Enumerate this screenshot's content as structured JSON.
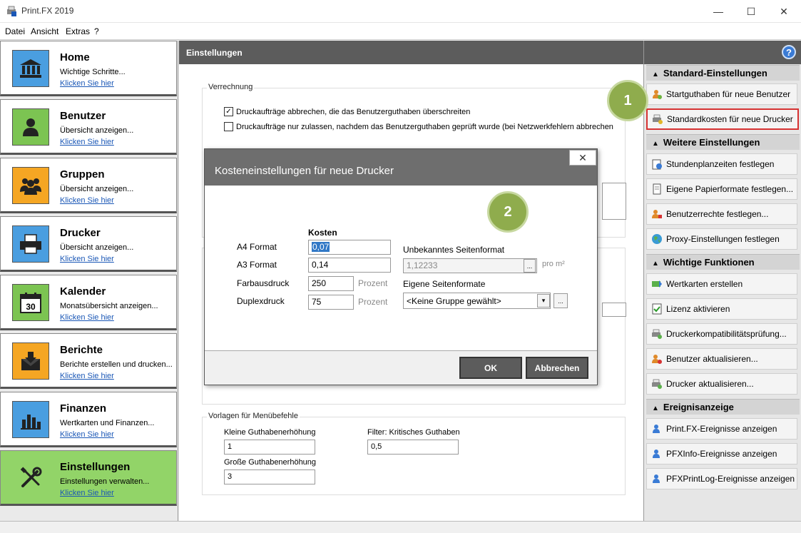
{
  "window": {
    "title": "Print.FX 2019"
  },
  "menu": [
    "Datei",
    "Ansicht",
    "Extras",
    "?"
  ],
  "nav": [
    {
      "title": "Home",
      "subtitle": "Wichtige Schritte...",
      "link": "Klicken Sie hier",
      "icon": "home-icon",
      "color": "#4a9ee0"
    },
    {
      "title": "Benutzer",
      "subtitle": "Übersicht anzeigen...",
      "link": "Klicken Sie hier",
      "icon": "user-icon",
      "color": "#7cc452"
    },
    {
      "title": "Gruppen",
      "subtitle": "Übersicht anzeigen...",
      "link": "Klicken Sie hier",
      "icon": "group-icon",
      "color": "#f5a623"
    },
    {
      "title": "Drucker",
      "subtitle": "Übersicht anzeigen...",
      "link": "Klicken Sie hier",
      "icon": "printer-icon",
      "color": "#4a9ee0"
    },
    {
      "title": "Kalender",
      "subtitle": "Monatsübersicht anzeigen...",
      "link": "Klicken Sie hier",
      "icon": "calendar-icon",
      "color": "#7cc452"
    },
    {
      "title": "Berichte",
      "subtitle": "Berichte erstellen und drucken...",
      "link": "Klicken Sie hier",
      "icon": "report-icon",
      "color": "#f5a623"
    },
    {
      "title": "Finanzen",
      "subtitle": "Wertkarten und Finanzen...",
      "link": "Klicken Sie hier",
      "icon": "finance-icon",
      "color": "#4a9ee0"
    },
    {
      "title": "Einstellungen",
      "subtitle": "Einstellungen verwalten...",
      "link": "Klicken Sie hier",
      "icon": "settings-icon",
      "color": "#92d468"
    }
  ],
  "center": {
    "header": "Einstellungen",
    "verrechnung": {
      "label": "Verrechnung",
      "check1": "Druckaufträge abbrechen, die das Benutzerguthaben überschreiten",
      "check2": "Druckaufträge nur zulassen, nachdem das Benutzerguthaben geprüft wurde (bei Netzwerkfehlern abbrechen"
    },
    "vorlagen": {
      "label": "Vorlagen für Menübefehle",
      "kleine_label": "Kleine Guthabenerhöhung",
      "kleine_value": "1",
      "grosse_label": "Große Guthabenerhöhung",
      "grosse_value": "3",
      "filter_label": "Filter: Kritisches Guthaben",
      "filter_value": "0,5"
    }
  },
  "right": {
    "sections": [
      {
        "title": "Standard-Einstellungen",
        "items": [
          "Startguthaben für neue Benutzer",
          "Standardkosten für neue Drucker"
        ]
      },
      {
        "title": "Weitere Einstellungen",
        "items": [
          "Stundenplanzeiten festlegen",
          "Eigene Papierformate festlegen...",
          "Benutzerrechte festlegen...",
          "Proxy-Einstellungen festlegen"
        ]
      },
      {
        "title": "Wichtige Funktionen",
        "items": [
          "Wertkarten erstellen",
          "Lizenz aktivieren",
          "Druckerkompatibilitätsprüfung...",
          "Benutzer aktualisieren...",
          "Drucker aktualisieren..."
        ]
      },
      {
        "title": "Ereignisanzeige",
        "items": [
          "Print.FX-Ereignisse anzeigen",
          "PFXInfo-Ereignisse anzeigen",
          "PFXPrintLog-Ereignisse anzeigen"
        ]
      }
    ]
  },
  "dialog": {
    "title": "Kosteneinstellungen für neue Drucker",
    "kosten_header": "Kosten",
    "a4_label": "A4 Format",
    "a4_value": "0,07",
    "a3_label": "A3 Format",
    "a3_value": "0,14",
    "farb_label": "Farbausdruck",
    "farb_value": "250",
    "farb_unit": "Prozent",
    "duplex_label": "Duplexdruck",
    "duplex_value": "75",
    "duplex_unit": "Prozent",
    "unbekannt_label": "Unbekanntes Seitenformat",
    "unbekannt_value": "1,12233",
    "unbekannt_unit": "pro m²",
    "eigene_label": "Eigene Seitenformate",
    "eigene_value": "<Keine Gruppe gewählt>",
    "ok": "OK",
    "cancel": "Abbrechen",
    "close": "✕"
  },
  "badges": {
    "one": "1",
    "two": "2"
  },
  "colors": {
    "accent_green": "#92d468",
    "header_gray": "#5c5c5c",
    "highlight_red": "#d63232",
    "badge_green": "#8fac4d"
  }
}
